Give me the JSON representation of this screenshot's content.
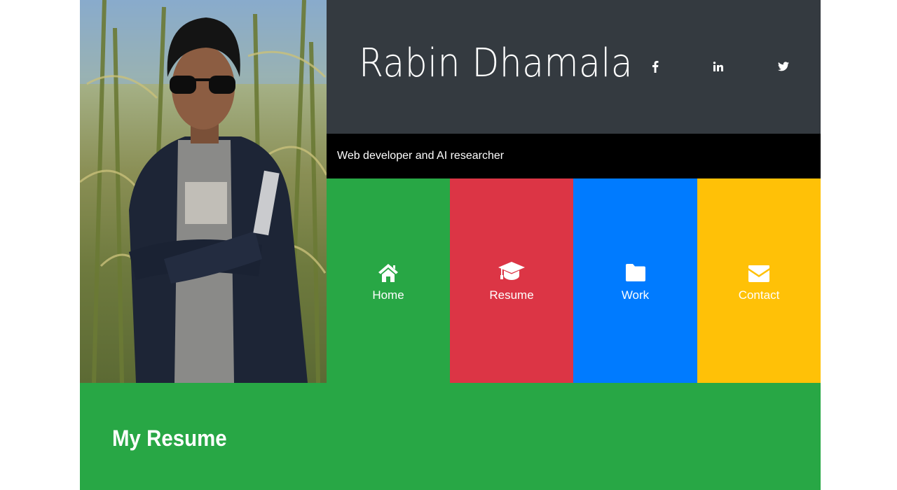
{
  "header": {
    "name": "Rabin Dhamala",
    "social": [
      {
        "icon": "facebook-icon",
        "label": "f"
      },
      {
        "icon": "linkedin-icon",
        "label": "in"
      },
      {
        "icon": "twitter-icon",
        "label": "twitter"
      }
    ]
  },
  "tagline": "Web developer and AI researcher",
  "nav": {
    "home": {
      "label": "Home",
      "icon": "home-icon",
      "color": "#28a745"
    },
    "resume": {
      "label": "Resume",
      "icon": "graduation-cap-icon",
      "color": "#dc3545"
    },
    "work": {
      "label": "Work",
      "icon": "folder-icon",
      "color": "#007bff"
    },
    "contact": {
      "label": "Contact",
      "icon": "envelope-icon",
      "color": "#ffc107"
    }
  },
  "resume_section": {
    "title": "My Resume"
  },
  "colors": {
    "header_bg": "#343a40",
    "tagline_bg": "#000000",
    "accent_green": "#28a745"
  }
}
